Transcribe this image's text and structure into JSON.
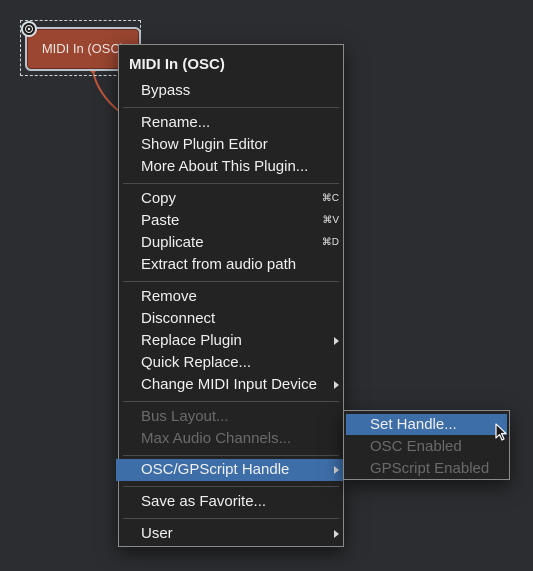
{
  "plugin": {
    "title": "MIDI In (OSC)"
  },
  "menu": {
    "header": "MIDI In (OSC)",
    "items": {
      "bypass": "Bypass",
      "rename": "Rename...",
      "show_editor": "Show Plugin Editor",
      "more_about": "More About This Plugin...",
      "copy": "Copy",
      "copy_shortcut": "⌘C",
      "paste": "Paste",
      "paste_shortcut": "⌘V",
      "duplicate": "Duplicate",
      "duplicate_shortcut": "⌘D",
      "extract": "Extract from audio path",
      "remove": "Remove",
      "disconnect": "Disconnect",
      "replace": "Replace Plugin",
      "quick_replace": "Quick Replace...",
      "change_midi": "Change MIDI Input Device",
      "bus_layout": "Bus Layout...",
      "max_audio": "Max Audio Channels...",
      "osc_handle": "OSC/GPScript Handle",
      "save_favorite": "Save as Favorite...",
      "user": "User"
    }
  },
  "submenu": {
    "set_handle": "Set Handle...",
    "osc_enabled": "OSC Enabled",
    "gpscript_enabled": "GPScript Enabled"
  },
  "colors": {
    "background": "#2b2d30",
    "plugin": "#9a4630",
    "highlight": "#3e6ea8",
    "menu_bg": "#232323"
  }
}
